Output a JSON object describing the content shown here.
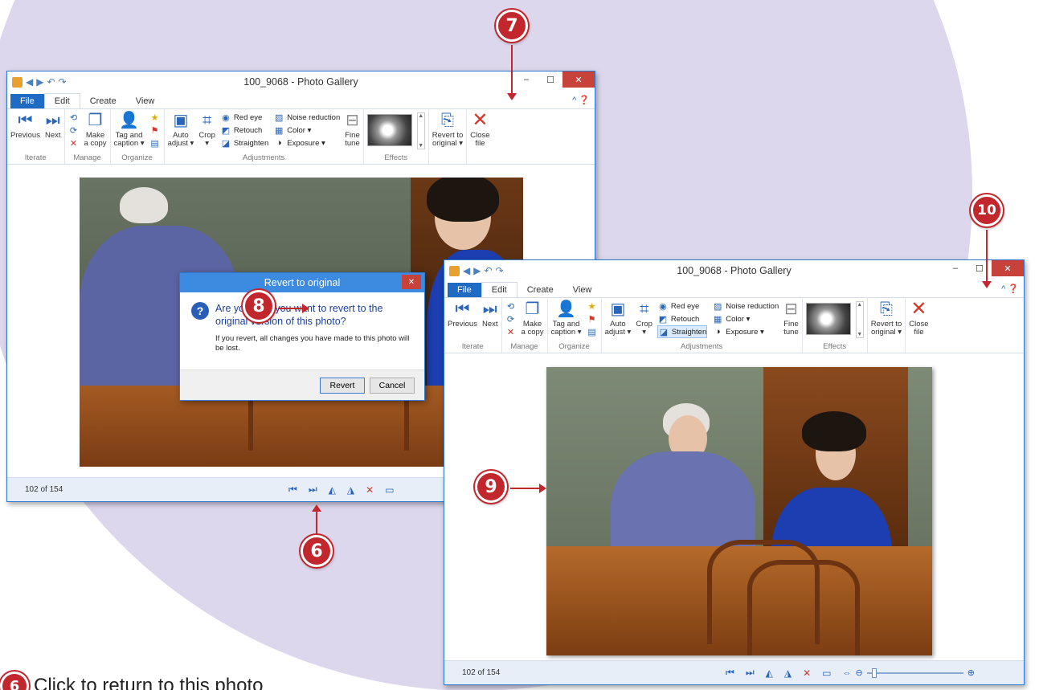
{
  "windows": {
    "back": {
      "title": "100_9068 - Photo Gallery",
      "status_count": "102 of 154"
    },
    "front": {
      "title": "100_9068 - Photo Gallery",
      "status_count": "102 of 154"
    }
  },
  "tabs": [
    "File",
    "Edit",
    "Create",
    "View"
  ],
  "ribbon": {
    "iterate": {
      "label": "Iterate",
      "previous": "Previous",
      "next": "Next"
    },
    "manage": {
      "label": "Manage",
      "make_copy_1": "Make",
      "make_copy_2": "a copy"
    },
    "organize": {
      "label": "Organize",
      "tag_1": "Tag and",
      "tag_2": "caption ▾"
    },
    "adjustments": {
      "label": "Adjustments",
      "auto_1": "Auto",
      "auto_2": "adjust ▾",
      "crop_1": "Crop",
      "crop_2": "▾",
      "red_eye": "Red eye",
      "retouch": "Retouch",
      "straighten": "Straighten",
      "noise": "Noise reduction",
      "color": "Color ▾",
      "exposure": "Exposure ▾",
      "fine_1": "Fine",
      "fine_2": "tune"
    },
    "effects": {
      "label": "Effects"
    },
    "revert": {
      "line1": "Revert to",
      "line2": "original ▾"
    },
    "close": {
      "line1": "Close",
      "line2": "file"
    }
  },
  "dialog": {
    "title": "Revert to original",
    "question": "Are you sure you want to revert to the original version of this photo?",
    "detail": "If you revert, all changes you have made to this photo will be lost.",
    "revert_button": "Revert",
    "cancel_button": "Cancel"
  },
  "callouts": {
    "c6": "6",
    "c7": "7",
    "c8": "8",
    "c9": "9",
    "c10": "10"
  },
  "caption": {
    "number": "6",
    "text": "Click to return to this photo"
  },
  "colors": {
    "callout": "#c1272d",
    "file_tab": "#1f6bc4",
    "window_border": "#2b7bd0"
  }
}
